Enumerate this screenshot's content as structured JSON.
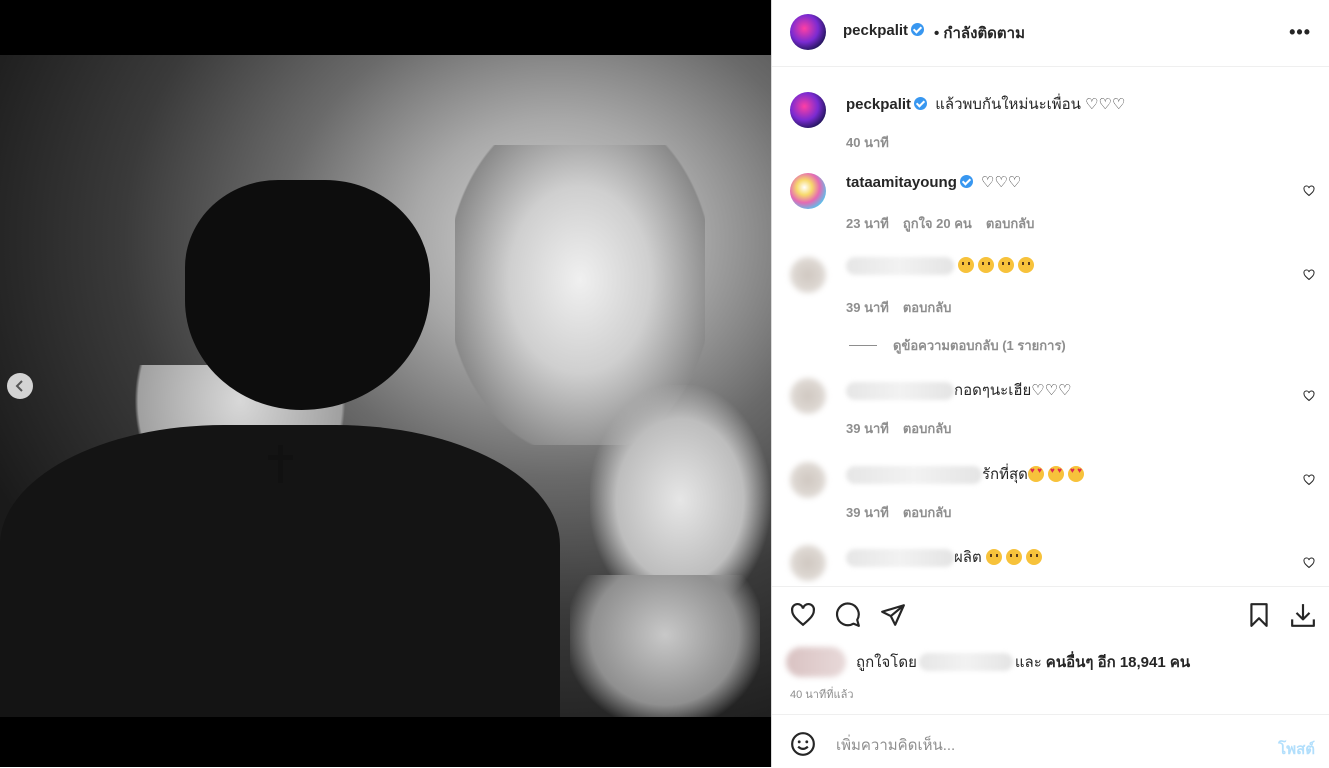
{
  "post": {
    "username": "peckpalit",
    "follow_status": "• กำลังติดตาม",
    "more_label": "•••",
    "caption": {
      "text": "แล้วพบกันใหม่นะเพื่อน ♡♡♡",
      "time": "40 นาที"
    },
    "carousel": {
      "total": 2,
      "current": 2
    }
  },
  "comments": [
    {
      "username": "tataamitayoung",
      "text": "♡♡♡",
      "time": "23 นาที",
      "likes": "ถูกใจ 20 คน",
      "reply": "ตอบกลับ",
      "verified": true
    },
    {
      "username": "",
      "text": "",
      "emoji": "sad",
      "emoji_count": 4,
      "time": "39 นาที",
      "reply": "ตอบกลับ"
    },
    {
      "username": "",
      "text": "กอดๆนะเฮีย♡♡♡",
      "time": "39 นาที",
      "reply": "ตอบกลับ"
    },
    {
      "username": "",
      "text": "รักที่สุด",
      "emoji": "love",
      "emoji_count": 3,
      "time": "39 นาที",
      "reply": "ตอบกลับ"
    },
    {
      "username": "",
      "text": "ผลิต",
      "emoji": "sad",
      "emoji_count": 3
    }
  ],
  "view_replies": "ดูข้อความตอบกลับ (1 รายการ)",
  "likes": {
    "prefix": "ถูกใจโดย",
    "suffix_and": "และ",
    "suffix_bold": "คนอื่นๆ อีก 18,941 คน"
  },
  "time_ago": "40 นาทีที่แล้ว",
  "add_comment": {
    "placeholder": "เพิ่มความคิดเห็น...",
    "post_label": "โพสต์"
  }
}
